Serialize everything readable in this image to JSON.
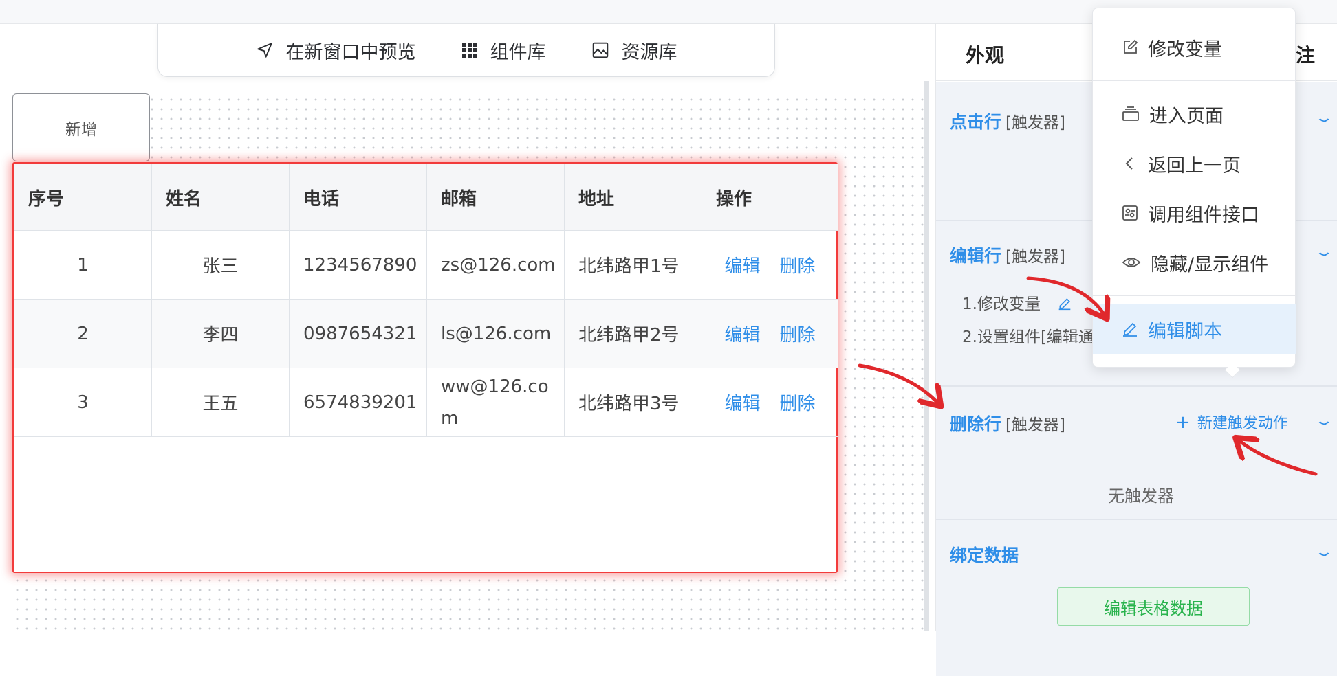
{
  "toolbar": {
    "preview_label": "在新窗口中预览",
    "components_label": "组件库",
    "assets_label": "资源库"
  },
  "canvas": {
    "add_button_label": "新增"
  },
  "table": {
    "headers": [
      "序号",
      "姓名",
      "电话",
      "邮箱",
      "地址",
      "操作"
    ],
    "rows": [
      {
        "index": "1",
        "name": "张三",
        "phone": "1234567890",
        "email": "zs@126.com",
        "address": "北纬路甲1号",
        "edit": "编辑",
        "delete": "删除"
      },
      {
        "index": "2",
        "name": "李四",
        "phone": "0987654321",
        "email": "ls@126.com",
        "address": "北纬路甲2号",
        "edit": "编辑",
        "delete": "删除"
      },
      {
        "index": "3",
        "name": "王五",
        "phone": "6574839201",
        "email": "ww@126.com",
        "address": "北纬路甲3号",
        "edit": "编辑",
        "delete": "删除"
      }
    ]
  },
  "side": {
    "tab_appearance": "外观",
    "tab_note": "注",
    "sections": {
      "click_row": {
        "title": "点击行",
        "sub": "[触发器]"
      },
      "edit_row": {
        "title": "编辑行",
        "sub": "[触发器]",
        "action1": "1.修改变量",
        "action2": "2.设置组件[编辑通"
      },
      "delete_row": {
        "title": "删除行",
        "sub": "[触发器]",
        "new_action": "新建触发动作",
        "empty": "无触发器"
      },
      "bind_data": {
        "title": "绑定数据",
        "edit_button": "编辑表格数据"
      }
    }
  },
  "menu": {
    "items": [
      "修改变量",
      "进入页面",
      "返回上一页",
      "调用组件接口",
      "隐藏/显示组件",
      "编辑脚本"
    ],
    "active_item": "编辑脚本"
  },
  "colors": {
    "accent": "#2f8ee8",
    "highlight_border": "#f23b3b",
    "arrow": "#e0282c",
    "success": "#29b34d"
  }
}
